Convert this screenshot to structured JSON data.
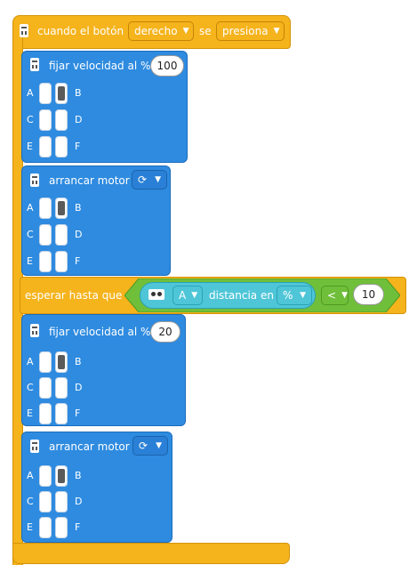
{
  "event_block": {
    "prefix": "cuando el botón",
    "button_value": "derecho",
    "middle": "se",
    "action_value": "presiona"
  },
  "ports": {
    "A": "A",
    "B": "B",
    "C": "C",
    "D": "D",
    "E": "E",
    "F": "F"
  },
  "block1": {
    "label": "fijar velocidad al %",
    "value": "100"
  },
  "block2": {
    "label": "arrancar motor",
    "direction_icon": "rotate-clockwise-icon"
  },
  "wait_block": {
    "label": "esperar hasta que",
    "sensor_port": "A",
    "measure_label": "distancia en",
    "unit": "%",
    "comparator": "<",
    "value": "10"
  },
  "block3": {
    "label": "fijar velocidad al %",
    "value": "20"
  },
  "block4": {
    "label": "arrancar motor",
    "direction_icon": "rotate-clockwise-icon"
  },
  "colors": {
    "event_yellow": "#f5b31c",
    "motor_blue": "#2e8be0",
    "sensor_teal": "#4fc6d8",
    "wait_green": "#6fbf3a"
  }
}
